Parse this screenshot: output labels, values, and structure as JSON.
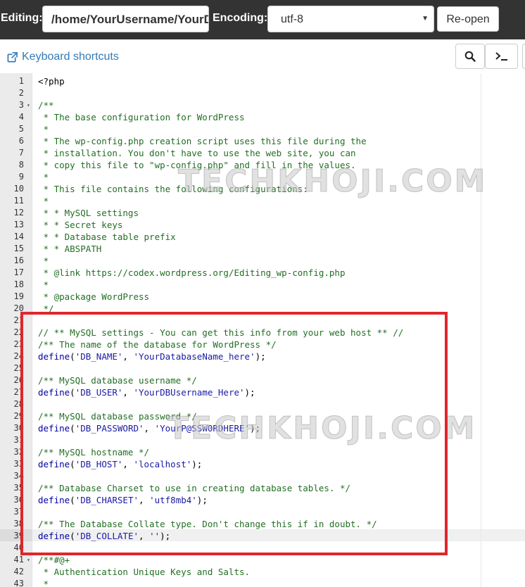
{
  "toolbar": {
    "editing_label": "Editing:",
    "path_value": "/home/YourUsername/YourDomain/wp-config.php",
    "encoding_label": "Encoding:",
    "encoding_value": "utf-8",
    "reopen_label": "Re-open",
    "search_icon": "search-icon",
    "terminal_icon": "terminal-icon"
  },
  "subbar": {
    "keyboard_shortcuts_label": "Keyboard shortcuts",
    "external_link_icon": "external-link-icon"
  },
  "watermark": {
    "text_1": "TECHKHOJI.COM",
    "text_2": "TECHKHOJI.COM"
  },
  "colors": {
    "highlight_box": "#e0262c",
    "link": "#337ab7",
    "comment": "#236e24",
    "function": "#0000a2",
    "string": "#1a1aa6"
  },
  "editor": {
    "active_line": "39",
    "lines": [
      {
        "num": "1",
        "fold": "",
        "tokens": [
          {
            "t": "text",
            "v": "<?php"
          }
        ]
      },
      {
        "num": "2",
        "fold": "",
        "tokens": []
      },
      {
        "num": "3",
        "fold": "▾",
        "tokens": [
          {
            "t": "comment",
            "v": "/**"
          }
        ]
      },
      {
        "num": "4",
        "fold": "",
        "tokens": [
          {
            "t": "comment",
            "v": " * The base configuration for WordPress"
          }
        ]
      },
      {
        "num": "5",
        "fold": "",
        "tokens": [
          {
            "t": "comment",
            "v": " *"
          }
        ]
      },
      {
        "num": "6",
        "fold": "",
        "tokens": [
          {
            "t": "comment",
            "v": " * The wp-config.php creation script uses this file during the"
          }
        ]
      },
      {
        "num": "7",
        "fold": "",
        "tokens": [
          {
            "t": "comment",
            "v": " * installation. You don't have to use the web site, you can"
          }
        ]
      },
      {
        "num": "8",
        "fold": "",
        "tokens": [
          {
            "t": "comment",
            "v": " * copy this file to \"wp-config.php\" and fill in the values."
          }
        ]
      },
      {
        "num": "9",
        "fold": "",
        "tokens": [
          {
            "t": "comment",
            "v": " *"
          }
        ]
      },
      {
        "num": "10",
        "fold": "",
        "tokens": [
          {
            "t": "comment",
            "v": " * This file contains the following configurations:"
          }
        ]
      },
      {
        "num": "11",
        "fold": "",
        "tokens": [
          {
            "t": "comment",
            "v": " *"
          }
        ]
      },
      {
        "num": "12",
        "fold": "",
        "tokens": [
          {
            "t": "comment",
            "v": " * * MySQL settings"
          }
        ]
      },
      {
        "num": "13",
        "fold": "",
        "tokens": [
          {
            "t": "comment",
            "v": " * * Secret keys"
          }
        ]
      },
      {
        "num": "14",
        "fold": "",
        "tokens": [
          {
            "t": "comment",
            "v": " * * Database table prefix"
          }
        ]
      },
      {
        "num": "15",
        "fold": "",
        "tokens": [
          {
            "t": "comment",
            "v": " * * ABSPATH"
          }
        ]
      },
      {
        "num": "16",
        "fold": "",
        "tokens": [
          {
            "t": "comment",
            "v": " *"
          }
        ]
      },
      {
        "num": "17",
        "fold": "",
        "tokens": [
          {
            "t": "comment",
            "v": " * @link https://codex.wordpress.org/Editing_wp-config.php"
          }
        ]
      },
      {
        "num": "18",
        "fold": "",
        "tokens": [
          {
            "t": "comment",
            "v": " *"
          }
        ]
      },
      {
        "num": "19",
        "fold": "",
        "tokens": [
          {
            "t": "comment",
            "v": " * @package WordPress"
          }
        ]
      },
      {
        "num": "20",
        "fold": "",
        "tokens": [
          {
            "t": "comment",
            "v": " */"
          }
        ]
      },
      {
        "num": "21",
        "fold": "",
        "tokens": []
      },
      {
        "num": "22",
        "fold": "",
        "tokens": [
          {
            "t": "comment",
            "v": "// ** MySQL settings - You can get this info from your web host ** //"
          }
        ]
      },
      {
        "num": "23",
        "fold": "",
        "tokens": [
          {
            "t": "comment",
            "v": "/** The name of the database for WordPress */"
          }
        ]
      },
      {
        "num": "24",
        "fold": "",
        "tokens": [
          {
            "t": "func",
            "v": "define"
          },
          {
            "t": "punc",
            "v": "("
          },
          {
            "t": "string",
            "v": "'DB_NAME'"
          },
          {
            "t": "punc",
            "v": ", "
          },
          {
            "t": "string",
            "v": "'YourDatabaseName_here'"
          },
          {
            "t": "punc",
            "v": ");"
          }
        ]
      },
      {
        "num": "25",
        "fold": "",
        "tokens": []
      },
      {
        "num": "26",
        "fold": "",
        "tokens": [
          {
            "t": "comment",
            "v": "/** MySQL database username */"
          }
        ]
      },
      {
        "num": "27",
        "fold": "",
        "tokens": [
          {
            "t": "func",
            "v": "define"
          },
          {
            "t": "punc",
            "v": "("
          },
          {
            "t": "string",
            "v": "'DB_USER'"
          },
          {
            "t": "punc",
            "v": ", "
          },
          {
            "t": "string",
            "v": "'YourDBUsername_Here'"
          },
          {
            "t": "punc",
            "v": ");"
          }
        ]
      },
      {
        "num": "28",
        "fold": "",
        "tokens": []
      },
      {
        "num": "29",
        "fold": "",
        "tokens": [
          {
            "t": "comment",
            "v": "/** MySQL database password */"
          }
        ]
      },
      {
        "num": "30",
        "fold": "",
        "tokens": [
          {
            "t": "func",
            "v": "define"
          },
          {
            "t": "punc",
            "v": "("
          },
          {
            "t": "string",
            "v": "'DB_PASSWORD'"
          },
          {
            "t": "punc",
            "v": ", "
          },
          {
            "t": "string",
            "v": "'YourP@SSW0RDHERE'"
          },
          {
            "t": "punc",
            "v": ");"
          }
        ]
      },
      {
        "num": "31",
        "fold": "",
        "tokens": []
      },
      {
        "num": "32",
        "fold": "",
        "tokens": [
          {
            "t": "comment",
            "v": "/** MySQL hostname */"
          }
        ]
      },
      {
        "num": "33",
        "fold": "",
        "tokens": [
          {
            "t": "func",
            "v": "define"
          },
          {
            "t": "punc",
            "v": "("
          },
          {
            "t": "string",
            "v": "'DB_HOST'"
          },
          {
            "t": "punc",
            "v": ", "
          },
          {
            "t": "string",
            "v": "'localhost'"
          },
          {
            "t": "punc",
            "v": ");"
          }
        ]
      },
      {
        "num": "34",
        "fold": "",
        "tokens": []
      },
      {
        "num": "35",
        "fold": "",
        "tokens": [
          {
            "t": "comment",
            "v": "/** Database Charset to use in creating database tables. */"
          }
        ]
      },
      {
        "num": "36",
        "fold": "",
        "tokens": [
          {
            "t": "func",
            "v": "define"
          },
          {
            "t": "punc",
            "v": "("
          },
          {
            "t": "string",
            "v": "'DB_CHARSET'"
          },
          {
            "t": "punc",
            "v": ", "
          },
          {
            "t": "string",
            "v": "'utf8mb4'"
          },
          {
            "t": "punc",
            "v": ");"
          }
        ]
      },
      {
        "num": "37",
        "fold": "",
        "tokens": []
      },
      {
        "num": "38",
        "fold": "",
        "tokens": [
          {
            "t": "comment",
            "v": "/** The Database Collate type. Don't change this if in doubt. */"
          }
        ]
      },
      {
        "num": "39",
        "fold": "",
        "tokens": [
          {
            "t": "func",
            "v": "define"
          },
          {
            "t": "punc",
            "v": "("
          },
          {
            "t": "string",
            "v": "'DB_COLLATE'"
          },
          {
            "t": "punc",
            "v": ", "
          },
          {
            "t": "string",
            "v": "''"
          },
          {
            "t": "punc",
            "v": ");"
          }
        ]
      },
      {
        "num": "40",
        "fold": "",
        "tokens": []
      },
      {
        "num": "41",
        "fold": "▾",
        "tokens": [
          {
            "t": "comment",
            "v": "/**#@+"
          }
        ]
      },
      {
        "num": "42",
        "fold": "",
        "tokens": [
          {
            "t": "comment",
            "v": " * Authentication Unique Keys and Salts."
          }
        ]
      },
      {
        "num": "43",
        "fold": "",
        "tokens": [
          {
            "t": "comment",
            "v": " *"
          }
        ]
      }
    ]
  }
}
